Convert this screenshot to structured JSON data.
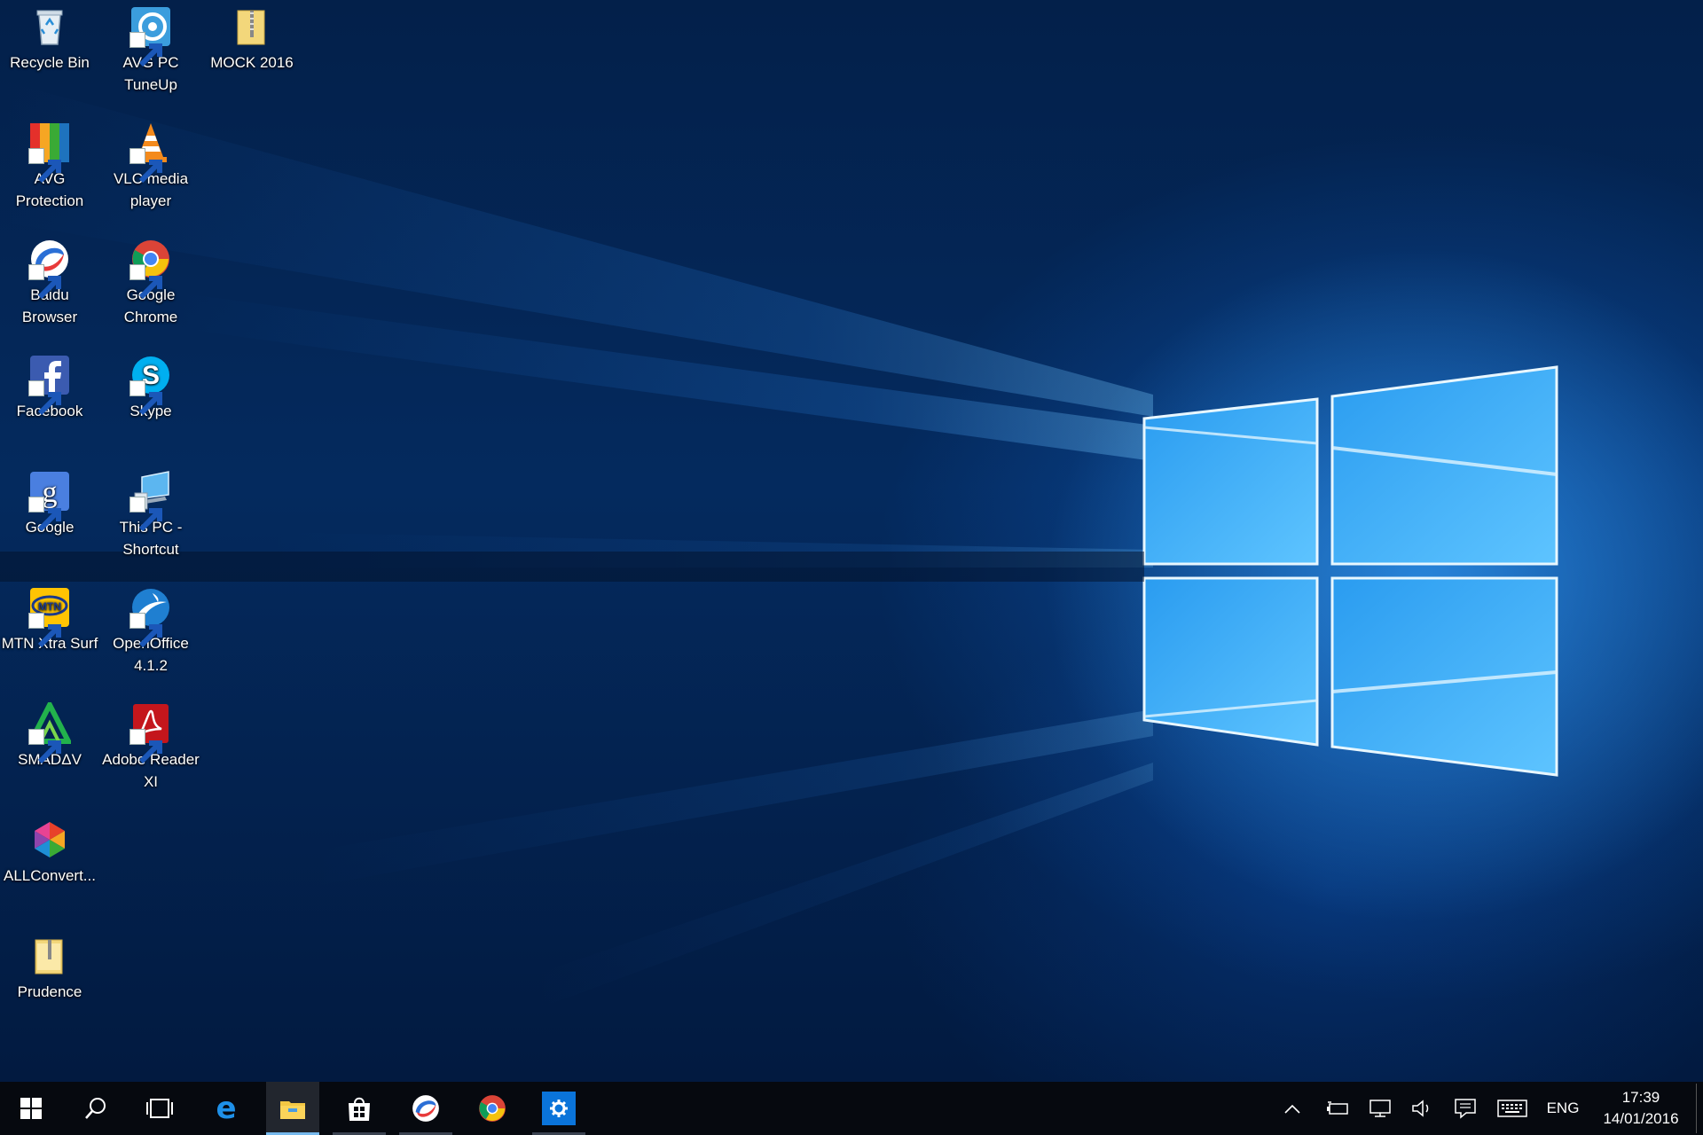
{
  "desktop": {
    "icons": [
      {
        "label": "Recycle Bin"
      },
      {
        "label": "AVG PC TuneUp"
      },
      {
        "label": "MOCK 2016"
      },
      {
        "label": "AVG Protection"
      },
      {
        "label": "VLC media player"
      },
      {
        "label": "Baidu Browser"
      },
      {
        "label": "Google Chrome"
      },
      {
        "label": "Facebook"
      },
      {
        "label": "Skype"
      },
      {
        "label": "Google"
      },
      {
        "label": "This PC - Shortcut"
      },
      {
        "label": "MTN Xtra Surf"
      },
      {
        "label": "OpenOffice 4.1.2"
      },
      {
        "label": "SMADΔV"
      },
      {
        "label": "Adobe Reader XI"
      },
      {
        "label": "ALLConvert..."
      },
      {
        "label": "Prudence"
      }
    ]
  },
  "taskbar": {
    "pinned": [
      {
        "icon": "windows-start-icon"
      },
      {
        "icon": "search-icon"
      },
      {
        "icon": "task-view-icon"
      },
      {
        "icon": "edge-icon"
      },
      {
        "icon": "file-explorer-icon",
        "active": true
      },
      {
        "icon": "store-icon"
      },
      {
        "icon": "baidu-browser-icon"
      },
      {
        "icon": "chrome-icon"
      },
      {
        "icon": "settings-icon"
      }
    ],
    "tray": {
      "language": "ENG",
      "time": "17:39",
      "date": "14/01/2016"
    }
  },
  "colors": {
    "accent": "#76b9ed",
    "taskbar": "#06090f",
    "settings_tile": "#0a74da"
  }
}
